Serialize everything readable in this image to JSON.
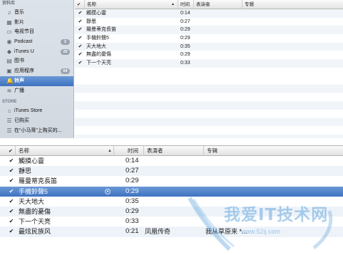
{
  "sidebar": {
    "library_header": "资料库",
    "items": [
      {
        "label": "音乐",
        "icon": "music-note-icon",
        "glyph": "♫",
        "badge": ""
      },
      {
        "label": "影片",
        "icon": "film-icon",
        "glyph": "▦",
        "badge": ""
      },
      {
        "label": "电视节目",
        "icon": "tv-icon",
        "glyph": "▭",
        "badge": ""
      },
      {
        "label": "Podcast",
        "icon": "podcast-icon",
        "glyph": "◉",
        "badge": "2"
      },
      {
        "label": "iTunes U",
        "icon": "graduation-cap-icon",
        "glyph": "◆",
        "badge": "25"
      },
      {
        "label": "图书",
        "icon": "book-icon",
        "glyph": "▤",
        "badge": ""
      },
      {
        "label": "应用程序",
        "icon": "apps-icon",
        "glyph": "▣",
        "badge": "64"
      },
      {
        "label": "铃声",
        "icon": "bell-icon",
        "glyph": "🔔",
        "badge": "",
        "selected": true
      },
      {
        "label": "广播",
        "icon": "radio-icon",
        "glyph": "≋",
        "badge": ""
      }
    ],
    "store_header": "STORE",
    "store_items": [
      {
        "label": "iTunes Store",
        "icon": "store-icon",
        "glyph": "⌂"
      },
      {
        "label": "已购买",
        "icon": "purchased-icon",
        "glyph": "☰"
      },
      {
        "label": "在“小马哥”上购买的...",
        "icon": "purchased-device-icon",
        "glyph": "☰"
      }
    ]
  },
  "top_list": {
    "columns": {
      "name": "名称",
      "time": "时间",
      "artist": "表演者",
      "album": "专辑"
    },
    "rows": [
      {
        "name": "觸摸心靈",
        "time": "0:14"
      },
      {
        "name": "靜思",
        "time": "0:27"
      },
      {
        "name": "羅曼蒂克長笛",
        "time": "0:29"
      },
      {
        "name": "手機鈴聲5",
        "time": "0:29"
      },
      {
        "name": "天大地大",
        "time": "0:35"
      },
      {
        "name": "無盡的憂傷",
        "time": "0:29"
      },
      {
        "name": "下一个天亮",
        "time": "0:33"
      }
    ]
  },
  "bottom_list": {
    "columns": {
      "name": "名称",
      "time": "时间",
      "artist": "表演者",
      "album": "专辑"
    },
    "rows": [
      {
        "name": "觸摸心靈",
        "time": "0:14",
        "artist": "",
        "album": ""
      },
      {
        "name": "靜思",
        "time": "0:27",
        "artist": "",
        "album": ""
      },
      {
        "name": "羅曼蒂克長笛",
        "time": "0:29",
        "artist": "",
        "album": ""
      },
      {
        "name": "手機鈴聲5",
        "time": "0:29",
        "artist": "",
        "album": "",
        "selected": true
      },
      {
        "name": "天大地大",
        "time": "0:35",
        "artist": "",
        "album": ""
      },
      {
        "name": "無盡的憂傷",
        "time": "0:29",
        "artist": "",
        "album": ""
      },
      {
        "name": "下一个天亮",
        "time": "0:33",
        "artist": "",
        "album": ""
      },
      {
        "name": "最炫民族风",
        "time": "0:21",
        "artist": "凤凰传奇",
        "album": "我从草原来 *..."
      }
    ]
  },
  "watermark": {
    "text": "我爱IT技术网",
    "url": "www.52ij.com"
  },
  "colors": {
    "selection": "#4f82cb",
    "sidebar_bg": "#d7dde5",
    "stripe": "#eef3f9"
  }
}
